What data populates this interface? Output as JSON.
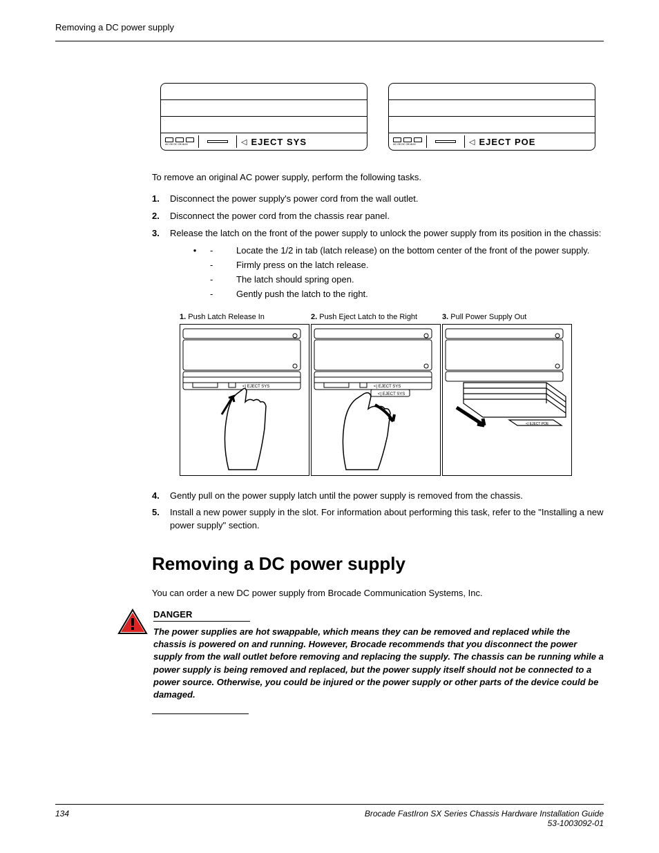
{
  "header": {
    "section_title": "Removing a DC power supply"
  },
  "figure1": {
    "led_labels": "AC OK DC OK   ALM",
    "eject_sys": "EJECT  SYS",
    "eject_poe": "EJECT  POE"
  },
  "intro": "To remove an original AC power supply, perform the following tasks.",
  "steps": {
    "s1_num": "1.",
    "s1": "Disconnect the power supply's power cord from the wall outlet.",
    "s2_num": "2.",
    "s2": "Disconnect the power cord from the chassis rear panel.",
    "s3_num": "3.",
    "s3": "Release the latch on the front of the power supply to unlock the power supply from its position in the chassis:",
    "sub_a": "Locate the 1/2 in tab (latch release) on the bottom center of the front of the power supply.",
    "sub_b": "Firmly press on the latch release.",
    "sub_c": "The latch should spring open.",
    "sub_d": "Gently push the latch to the right.",
    "s4_num": "4.",
    "s4": "Gently pull on the power supply latch until the power supply is removed from the chassis.",
    "s5_num": "5.",
    "s5": "Install a new power supply in the slot. For information about performing this task, refer to the \"Installing a new power supply\" section."
  },
  "figure2": {
    "cap1_num": "1.",
    "cap1": " Push Latch Release In",
    "cap2_num": "2.",
    "cap2": " Push Eject Latch to the Right",
    "cap3_num": "3.",
    "cap3": " Pull Power Supply Out"
  },
  "heading": "Removing a DC power supply",
  "dc_intro": "You can order a new DC power supply from Brocade Communication Systems, Inc.",
  "danger": {
    "label": "DANGER",
    "text": "The power supplies are hot swappable, which means they can be removed and replaced while the chassis is powered on and running. However, Brocade recommends that you disconnect the power supply from the wall outlet before removing and replacing the supply. The chassis can be running while a power supply is being removed and replaced, but the power supply itself should not be connected to a power source. Otherwise, you could be injured or the power supply or other parts of the device could be damaged."
  },
  "footer": {
    "page": "134",
    "doc_title": "Brocade FastIron SX Series Chassis Hardware Installation Guide",
    "doc_num": "53-1003092-01"
  }
}
